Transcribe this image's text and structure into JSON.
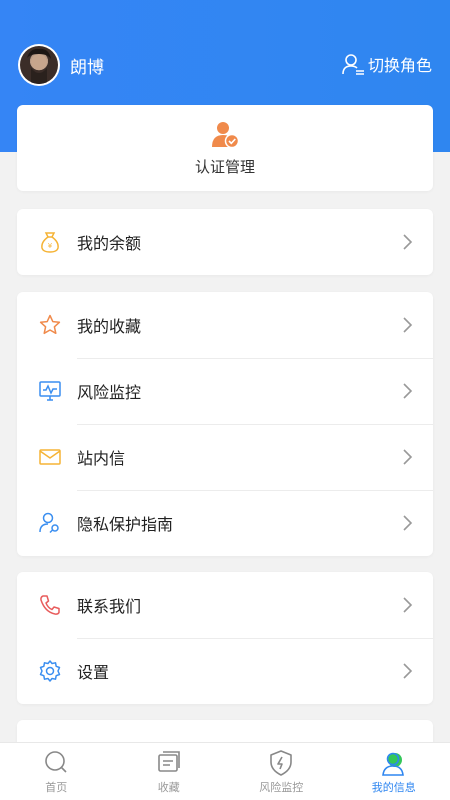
{
  "header": {
    "username": "朗博",
    "switch_role_label": "切换角色"
  },
  "auth": {
    "label": "认证管理"
  },
  "balance_group": [
    {
      "label": "我的余额",
      "icon": "money-bag-icon"
    }
  ],
  "main_group": [
    {
      "label": "我的收藏",
      "icon": "star-icon"
    },
    {
      "label": "风险监控",
      "icon": "monitor-icon"
    },
    {
      "label": "站内信",
      "icon": "envelope-icon"
    },
    {
      "label": "隐私保护指南",
      "icon": "privacy-icon"
    }
  ],
  "support_group": [
    {
      "label": "联系我们",
      "icon": "phone-icon"
    },
    {
      "label": "设置",
      "icon": "gear-icon"
    }
  ],
  "tabbar": [
    {
      "label": "首页",
      "icon": "search-icon",
      "active": false
    },
    {
      "label": "收藏",
      "icon": "bookmark-card-icon",
      "active": false
    },
    {
      "label": "风险监控",
      "icon": "shield-icon",
      "active": false
    },
    {
      "label": "我的信息",
      "icon": "user-icon",
      "active": true
    }
  ],
  "colors": {
    "brand_blue": "#2f86f0",
    "orange": "#f08a4b",
    "yellow": "#f5b335",
    "blue_icon": "#3a8ef0",
    "red_phone": "#e85c5c",
    "active_green": "#34c759"
  }
}
